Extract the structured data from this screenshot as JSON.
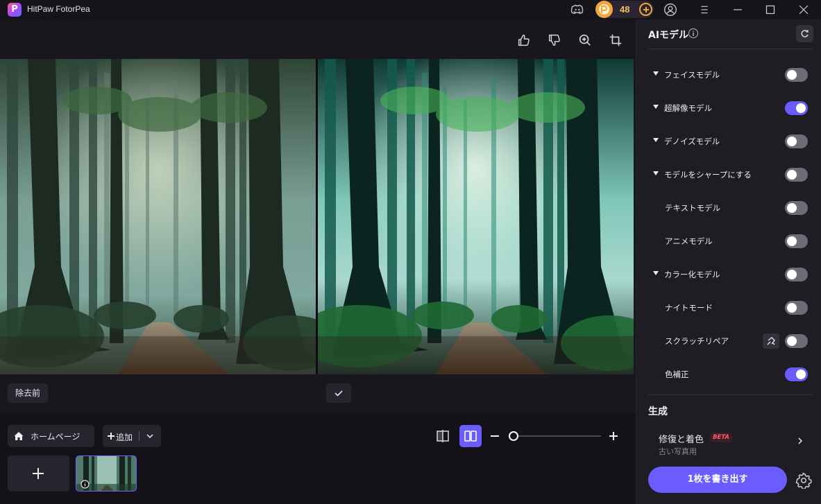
{
  "titlebar": {
    "app_name": "HitPaw FotorPea",
    "credits": "48",
    "icons": [
      "discord-icon",
      "coin-icon",
      "add-credits-icon",
      "user-icon",
      "menu-icon",
      "minimize-icon",
      "maximize-icon",
      "close-icon"
    ]
  },
  "toolbar": {
    "icons": [
      "thumbs-up-icon",
      "thumbs-down-icon",
      "zoom-in-icon",
      "crop-icon"
    ]
  },
  "preview": {
    "left_label": "除去前"
  },
  "bottom": {
    "home_label": "ホームページ",
    "add_label": "追加"
  },
  "panel": {
    "heading": "AIモデル",
    "models": [
      {
        "label": "フェイスモデル",
        "expandable": true,
        "on": false
      },
      {
        "label": "超解像モデル",
        "expandable": true,
        "on": true
      },
      {
        "label": "デノイズモデル",
        "expandable": true,
        "on": false
      },
      {
        "label": "モデルをシャープにする",
        "expandable": true,
        "on": false
      },
      {
        "label": "テキストモデル",
        "expandable": false,
        "on": false
      },
      {
        "label": "アニメモデル",
        "expandable": false,
        "on": false
      },
      {
        "label": "カラー化モデル",
        "expandable": true,
        "on": false
      },
      {
        "label": "ナイトモード",
        "expandable": false,
        "on": false
      },
      {
        "label": "スクラッチリペア",
        "expandable": false,
        "on": false
      },
      {
        "label": "色補正",
        "expandable": false,
        "on": true
      }
    ],
    "generate_heading": "生成",
    "generate_item": {
      "title": "修復と着色",
      "badge": "BETA",
      "subtitle": "古い写真用"
    },
    "export_label": "1枚を書き出す"
  },
  "colors": {
    "accent": "#6a5cff",
    "coin": "#f3a63a",
    "beta": "#ff5a6e"
  }
}
